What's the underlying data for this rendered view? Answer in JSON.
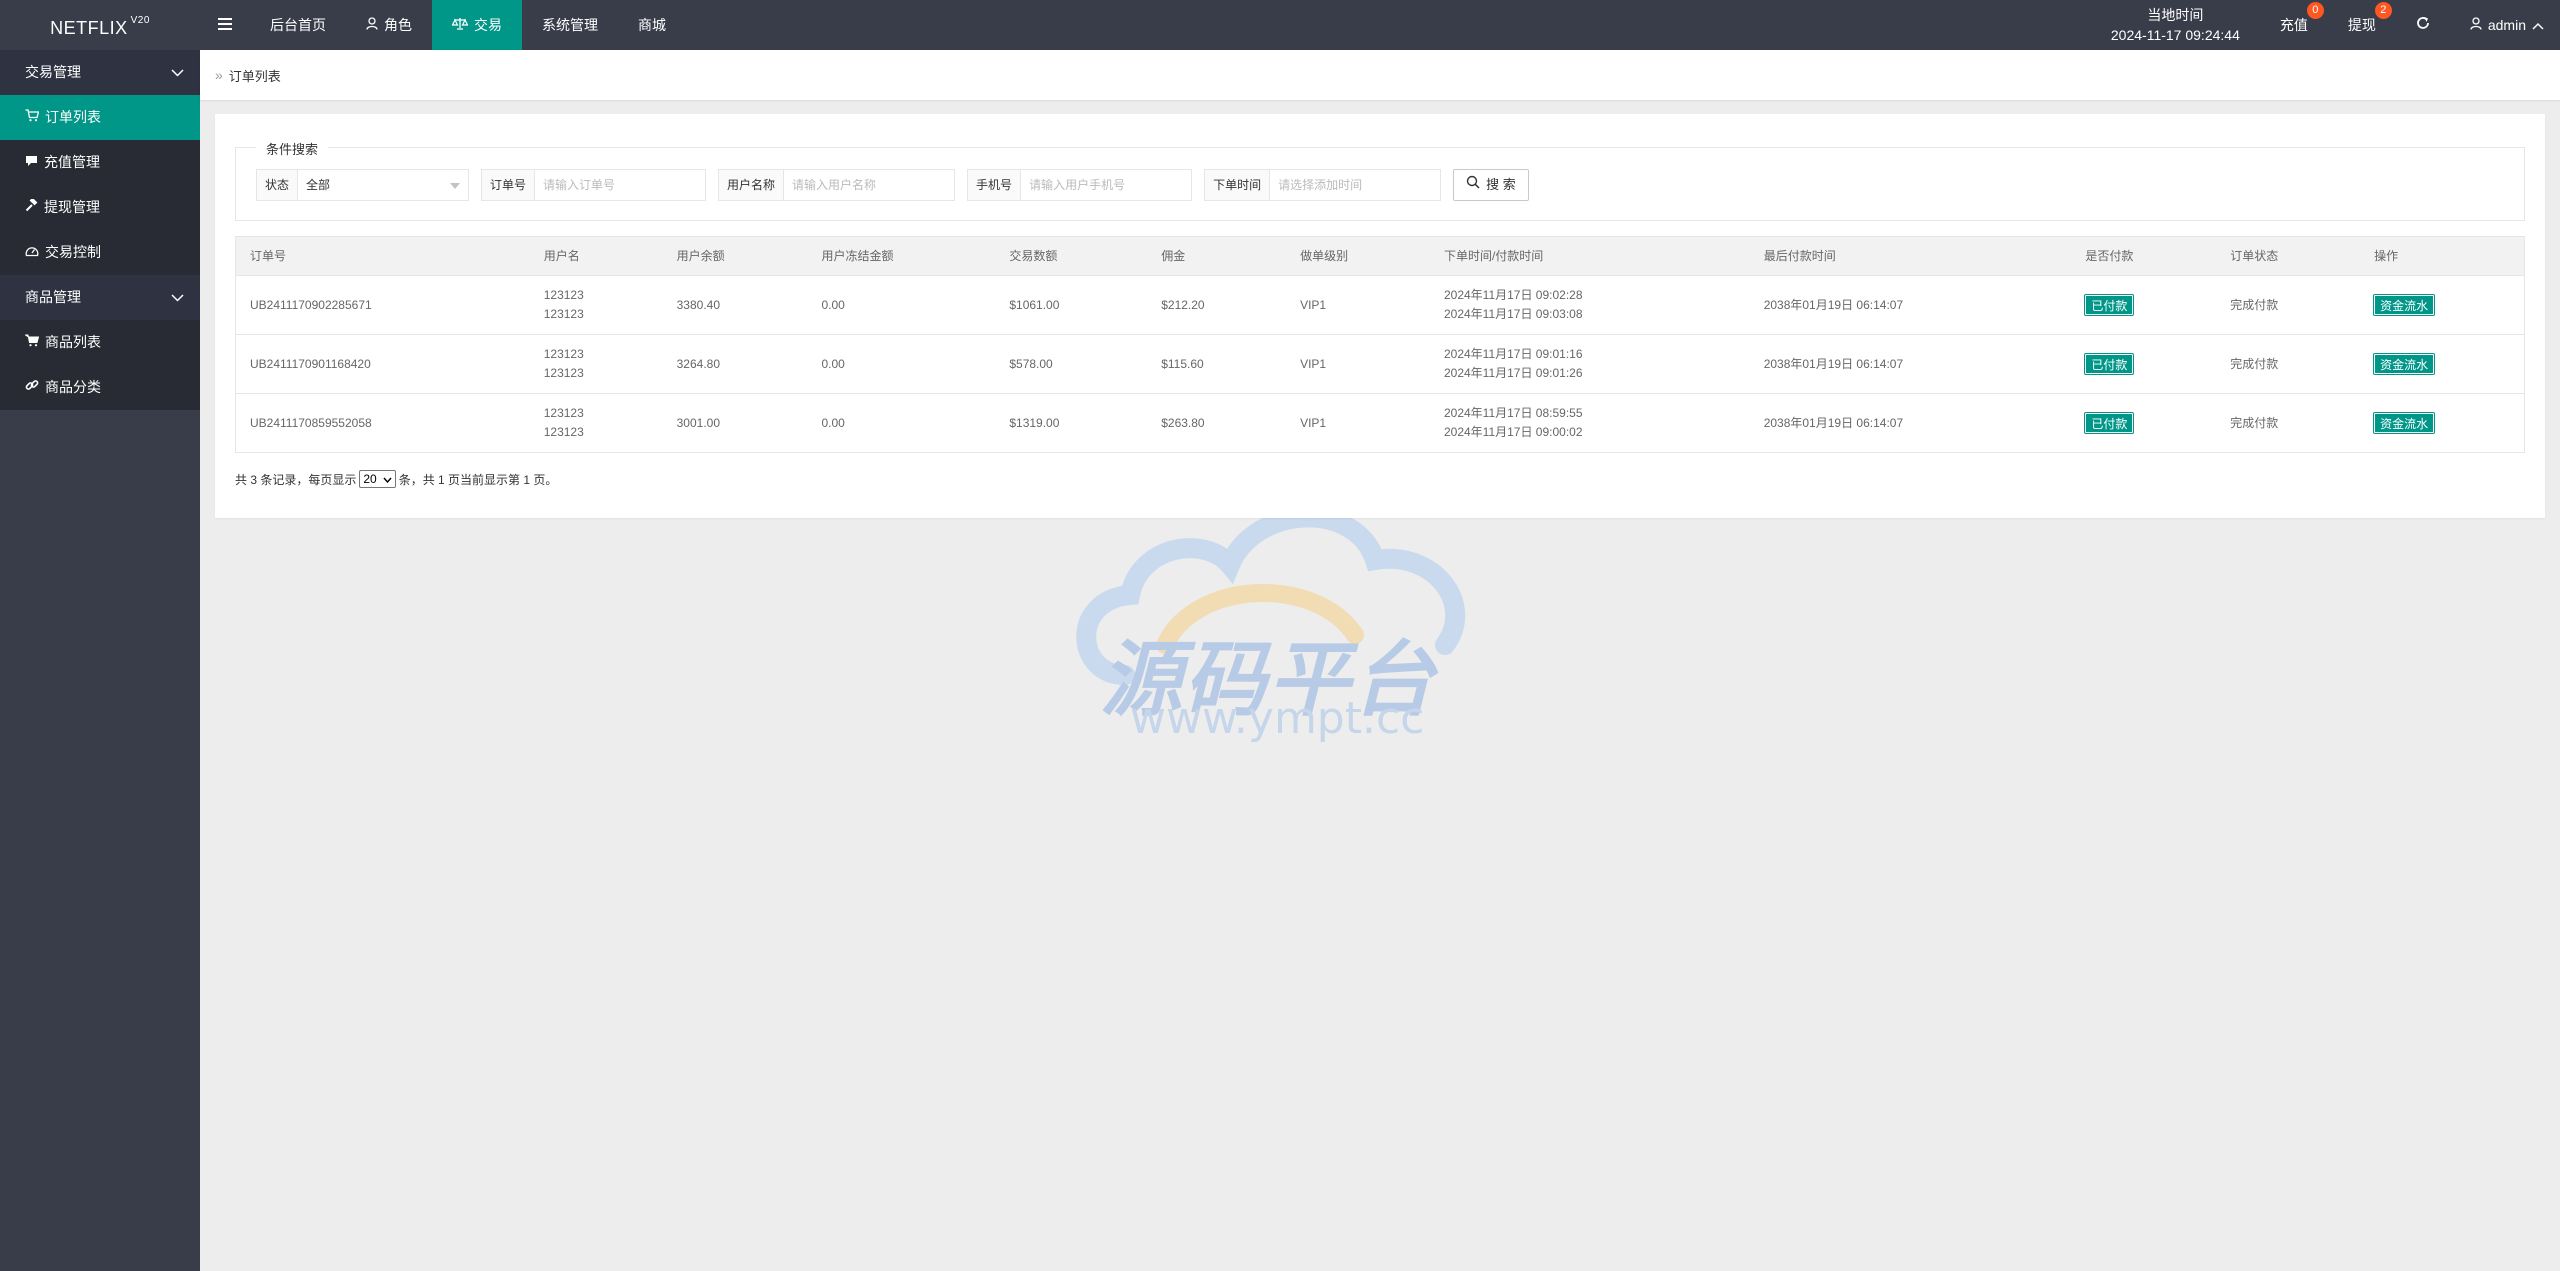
{
  "header": {
    "brand": "NETFLIX",
    "brand_version": "V20",
    "nav": [
      {
        "label": "后台首页",
        "icon": ""
      },
      {
        "label": "角色",
        "icon": "user-icon"
      },
      {
        "label": "交易",
        "icon": "scale-icon",
        "active": true
      },
      {
        "label": "系统管理",
        "icon": ""
      },
      {
        "label": "商城",
        "icon": ""
      }
    ],
    "time_label": "当地时间",
    "time_value": "2024-11-17 09:24:44",
    "recharge_label": "充值",
    "recharge_badge": "0",
    "withdraw_label": "提现",
    "withdraw_badge": "2",
    "user_label": "admin"
  },
  "sidebar": {
    "groups": [
      {
        "label": "交易管理",
        "items": [
          {
            "label": "订单列表",
            "icon": "cart-icon",
            "active": true
          },
          {
            "label": "充值管理",
            "icon": "chat-icon"
          },
          {
            "label": "提现管理",
            "icon": "hammer-icon"
          },
          {
            "label": "交易控制",
            "icon": "dashboard-icon"
          }
        ]
      },
      {
        "label": "商品管理",
        "items": [
          {
            "label": "商品列表",
            "icon": "cart-filled-icon"
          },
          {
            "label": "商品分类",
            "icon": "link-icon"
          }
        ]
      }
    ]
  },
  "breadcrumb": {
    "label": "订单列表"
  },
  "search": {
    "legend": "条件搜索",
    "status_label": "状态",
    "status_value": "全部",
    "order_label": "订单号",
    "order_placeholder": "请输入订单号",
    "username_label": "用户名称",
    "username_placeholder": "请输入用户名称",
    "phone_label": "手机号",
    "phone_placeholder": "请输入用户手机号",
    "time_label": "下单时间",
    "time_placeholder": "请选择添加时间",
    "button_label": "搜 索"
  },
  "table": {
    "headers": [
      "订单号",
      "用户名",
      "用户余额",
      "用户冻结金额",
      "交易数额",
      "佣金",
      "做单级别",
      "下单时间/付款时间",
      "最后付款时间",
      "是否付款",
      "订单状态",
      "操作"
    ],
    "rows": [
      {
        "order_no": "UB2411170902285671",
        "user1": "123123",
        "user2": "123123",
        "balance": "3380.40",
        "frozen": "0.00",
        "amount": "$1061.00",
        "commission": "$212.20",
        "level": "VIP1",
        "order_time": "2024年11月17日 09:02:28",
        "pay_time": "2024年11月17日 09:03:08",
        "last_pay": "2038年01月19日 06:14:07",
        "paid": "已付款",
        "status": "完成付款",
        "action": "资金流水"
      },
      {
        "order_no": "UB2411170901168420",
        "user1": "123123",
        "user2": "123123",
        "balance": "3264.80",
        "frozen": "0.00",
        "amount": "$578.00",
        "commission": "$115.60",
        "level": "VIP1",
        "order_time": "2024年11月17日 09:01:16",
        "pay_time": "2024年11月17日 09:01:26",
        "last_pay": "2038年01月19日 06:14:07",
        "paid": "已付款",
        "status": "完成付款",
        "action": "资金流水"
      },
      {
        "order_no": "UB2411170859552058",
        "user1": "123123",
        "user2": "123123",
        "balance": "3001.00",
        "frozen": "0.00",
        "amount": "$1319.00",
        "commission": "$263.80",
        "level": "VIP1",
        "order_time": "2024年11月17日 08:59:55",
        "pay_time": "2024年11月17日 09:00:02",
        "last_pay": "2038年01月19日 06:14:07",
        "paid": "已付款",
        "status": "完成付款",
        "action": "资金流水"
      }
    ]
  },
  "pager": {
    "prefix": "共 3 条记录，每页显示",
    "page_size": "20",
    "suffix": "条，共 1 页当前显示第 1 页。"
  },
  "watermark": {
    "main": "源码平台",
    "sub": "www.ympt.cc"
  },
  "colors": {
    "header_bg": "#393d49",
    "accent": "#009688",
    "badge": "#ff5722",
    "sidebar_item_bg": "#282b33"
  }
}
